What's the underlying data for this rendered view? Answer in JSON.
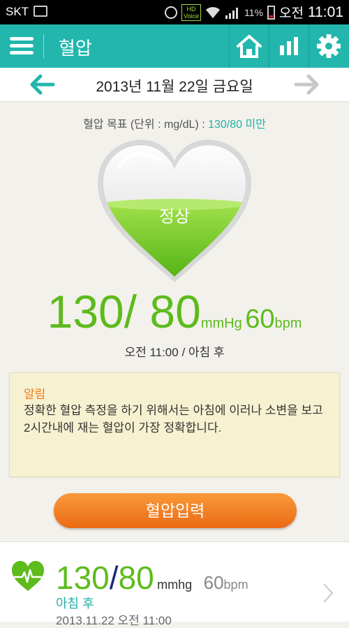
{
  "status_bar": {
    "carrier": "SKT",
    "hd_label_top": "HD",
    "hd_label_bottom": "Voice",
    "battery": "11%",
    "ampm": "오전",
    "time": "11:01"
  },
  "app_bar": {
    "title": "혈압",
    "icons": [
      "menu-icon",
      "home-icon",
      "chart-icon",
      "gear-icon"
    ],
    "color": "#22b6ad"
  },
  "date_nav": {
    "date": "2013년 11월 22일 금요일"
  },
  "goal": {
    "prefix": "혈압 목표 (단위 : mg/dL) : ",
    "value": "130/80 미만"
  },
  "status": {
    "label": "정상",
    "fill_fraction": 0.55
  },
  "reading": {
    "value": "130/ 80",
    "unit": "mmHg",
    "pulse": "60",
    "pulse_unit": "bpm",
    "time": "오전 11:00 / 아침 후"
  },
  "notice": {
    "title": "알림",
    "body": "정확한 혈압 측정을 하기 위해서는 아침에 이러나 소변을 보고 2시간내에 재는 혈압이 가장 정확합니다."
  },
  "input_button": {
    "label": "혈압입력"
  },
  "history": {
    "systolic": "130",
    "slash": "/",
    "diastolic": "80",
    "unit": "mmhg",
    "pulse": "60",
    "pulse_unit": "bpm",
    "meal": "아침 후",
    "datetime": "2013.11.22 오전 11:00"
  },
  "colors": {
    "accent": "#22b6ad",
    "green": "#5dbb1c",
    "orange": "#ec6a14"
  }
}
